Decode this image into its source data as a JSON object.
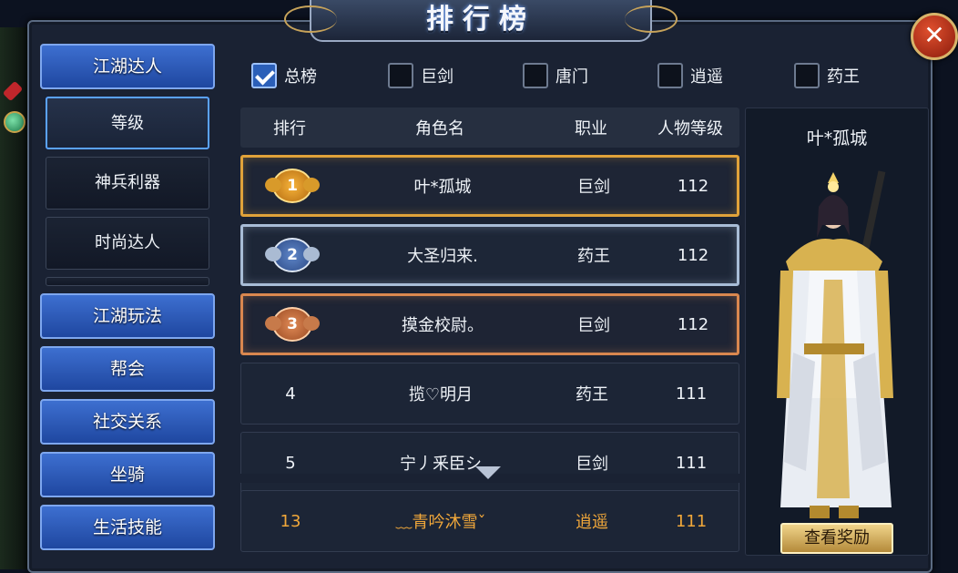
{
  "window": {
    "title": "排行榜"
  },
  "close_label": "✕",
  "menu": {
    "groups": [
      {
        "label": "江湖达人"
      },
      {
        "label": "江湖玩法"
      },
      {
        "label": "帮会"
      },
      {
        "label": "社交关系"
      },
      {
        "label": "坐骑"
      },
      {
        "label": "生活技能"
      }
    ],
    "subitems": [
      {
        "label": "等级",
        "active": true
      },
      {
        "label": "神兵利器"
      },
      {
        "label": "时尚达人"
      }
    ]
  },
  "filters": [
    {
      "label": "总榜",
      "checked": true
    },
    {
      "label": "巨剑",
      "checked": false
    },
    {
      "label": "唐门",
      "checked": false
    },
    {
      "label": "逍遥",
      "checked": false
    },
    {
      "label": "药王",
      "checked": false
    }
  ],
  "table": {
    "headers": {
      "rank": "排行",
      "name": "角色名",
      "job": "职业",
      "level": "人物等级"
    },
    "rows": [
      {
        "rank": "1",
        "name": "叶*孤城",
        "job": "巨剑",
        "level": "112"
      },
      {
        "rank": "2",
        "name": "大圣归来.",
        "job": "药王",
        "level": "112"
      },
      {
        "rank": "3",
        "name": "摸金校尉。",
        "job": "巨剑",
        "level": "112"
      },
      {
        "rank": "4",
        "name": "揽♡明月",
        "job": "药王",
        "level": "111"
      },
      {
        "rank": "5",
        "name": "宁丿釆臣シ",
        "job": "巨剑",
        "level": "111"
      }
    ],
    "self_row": {
      "rank": "13",
      "name": "﹏青吟沐雪ˇ",
      "job": "逍遥",
      "level": "111"
    }
  },
  "side_panel": {
    "name": "叶*孤城",
    "reward_button": "查看奖励"
  },
  "colors": {
    "gold": "#e0a23a",
    "silver": "#a8bcd6",
    "bronze": "#d9874f",
    "self_text": "#f0a73a",
    "menu_blue": "#2f5fc0"
  }
}
